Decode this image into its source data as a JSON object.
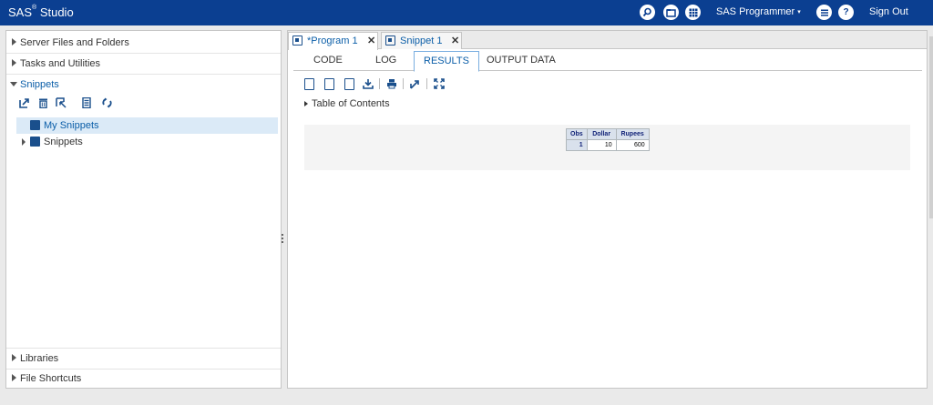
{
  "header": {
    "brand_name": "SAS",
    "brand_mark": "®",
    "brand_product": "Studio",
    "icons": [
      "search-icon",
      "open-folder-icon",
      "apps-grid-icon",
      "menu-list-icon",
      "help-icon"
    ],
    "help_glyph": "?",
    "user_label": "SAS Programmer",
    "user_caret": "▾",
    "sign_out": "Sign Out",
    "color": "#0b3f91"
  },
  "left_nav": {
    "sections": [
      {
        "label": "Server Files and Folders"
      },
      {
        "label": "Tasks and Utilities"
      },
      {
        "label": "Snippets",
        "expanded": true
      },
      {
        "label": "Libraries"
      },
      {
        "label": "File Shortcuts"
      }
    ],
    "snippet_tools": [
      "new-snippet-icon",
      "delete-icon",
      "open-icon",
      "properties-icon",
      "refresh-icon"
    ],
    "tree": [
      {
        "label": "My Snippets",
        "selected": true
      },
      {
        "label": "Snippets",
        "expandable": true
      }
    ]
  },
  "doc_tabs": [
    {
      "label": "*Program 1",
      "active": true,
      "close": "✕"
    },
    {
      "label": "Snippet 1",
      "active": false,
      "close": "✕"
    }
  ],
  "sub_tabs": [
    {
      "label": "CODE"
    },
    {
      "label": "LOG"
    },
    {
      "label": "RESULTS",
      "active": true
    },
    {
      "label": "OUTPUT DATA"
    }
  ],
  "results_toolbar": [
    "html-doc-icon",
    "pdf-doc-icon",
    "rtf-doc-icon",
    "download-icon",
    "print-icon",
    "open-new-window-icon",
    "maximize-icon"
  ],
  "toc_label": "Table of Contents",
  "output_table": {
    "columns": [
      "Obs",
      "Dollar",
      "Rupees"
    ],
    "rows": [
      [
        "1",
        "10",
        "600"
      ]
    ]
  }
}
